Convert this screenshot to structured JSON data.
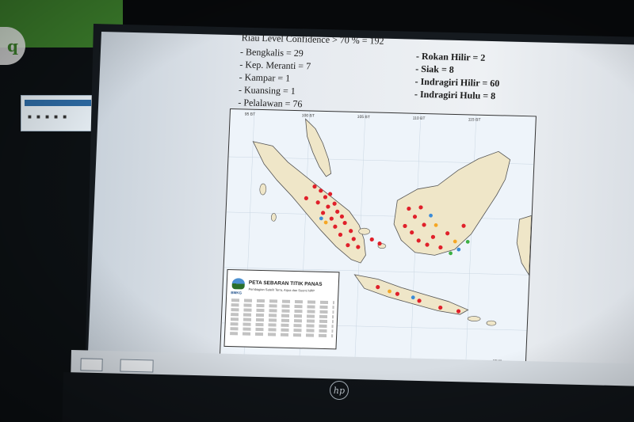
{
  "legend": {
    "header": "Riau Level Confidence > 70 % = 192",
    "left": [
      "- Bengkalis = 29",
      "- Kep. Meranti = 7",
      "- Kampar = 1",
      "- Kuansing = 1",
      "- Pelalawan = 76"
    ],
    "right": [
      "- Rokan Hilir = 2",
      "- Siak = 8",
      "- Indragiri Hilir = 60",
      "- Indragiri Hulu = 8"
    ]
  },
  "map": {
    "longitude_labels": [
      "95 BT",
      "100 BT",
      "105 BT",
      "110 BT",
      "115 BT"
    ],
    "info_title": "PETA SEBARAN TITIK PANAS",
    "info_subtitle": "Pembagian Satelit Terra, Aqua dan Suomi NPP",
    "agency": "BMKG",
    "hotspot_colors": {
      "high": "#e0202a",
      "medium": "#f5a623",
      "low": "#3b8bd8",
      "other": "#3cb043"
    }
  },
  "taskbar": {
    "item_1": "",
    "item_2": ""
  },
  "brand": "hp"
}
